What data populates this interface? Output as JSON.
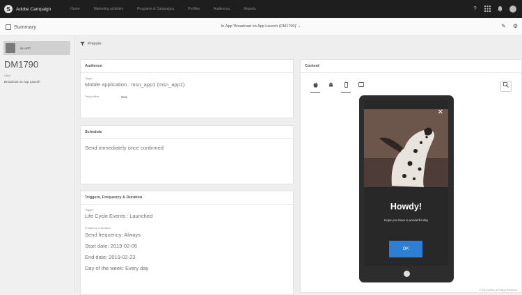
{
  "topbar": {
    "brand": "Adobe Campaign",
    "nav": [
      "Home",
      "Marketing activities",
      "Programs & Campaigns",
      "Profiles",
      "Audiences",
      "Reports"
    ]
  },
  "summary_bar": {
    "summary_label": "Summary",
    "delivery_title": "In-App 'Broadcast on App Launch (DM1790)'"
  },
  "sidebar": {
    "chip_label": "IN-APP",
    "code": "DM1790",
    "label_caption": "Label",
    "label_value": "Broadcast on App Launch"
  },
  "main": {
    "prepare_label": "Prepare",
    "audience": {
      "title": "Audience",
      "target_caption": "Target",
      "target_value": "Mobile application : msn_app1 (msn_app1)",
      "test_profiles_caption": "Test profiles",
      "test_profiles_value": "New"
    },
    "schedule": {
      "title": "Schedule",
      "value": "Send immediately once confirmed"
    },
    "triggers": {
      "title": "Triggers, Frequency & Duration",
      "trigger_caption": "Trigger",
      "trigger_value": "Life Cycle Events : Launched",
      "freq_caption": "Frequency & Duration",
      "send_frequency": "Send frequency: Always",
      "start_date": "Start date: 2019-02-06",
      "end_date": "End date: 2019-02-23",
      "day_of_week": "Day of the week: Every day"
    },
    "content": {
      "title": "Content",
      "message_title": "Howdy!",
      "message_body": "Hope you have a wonderful day",
      "button_label": "OK",
      "close_glyph": "✕"
    }
  },
  "footer": {
    "copyright": "© 2019 Adobe. All Rights Reserved."
  },
  "colors": {
    "topbar": "#1e1e1e",
    "button_blue": "#2d7fd3",
    "phone_body": "#2d2d2d"
  },
  "icons": {
    "help": "help-icon",
    "apps": "apps-grid-icon",
    "notifications": "bell-icon",
    "edit": "pencil-icon",
    "settings": "settings-icon",
    "ios": "apple-icon",
    "android": "android-icon",
    "phone": "phone-icon",
    "tablet": "tablet-icon"
  }
}
